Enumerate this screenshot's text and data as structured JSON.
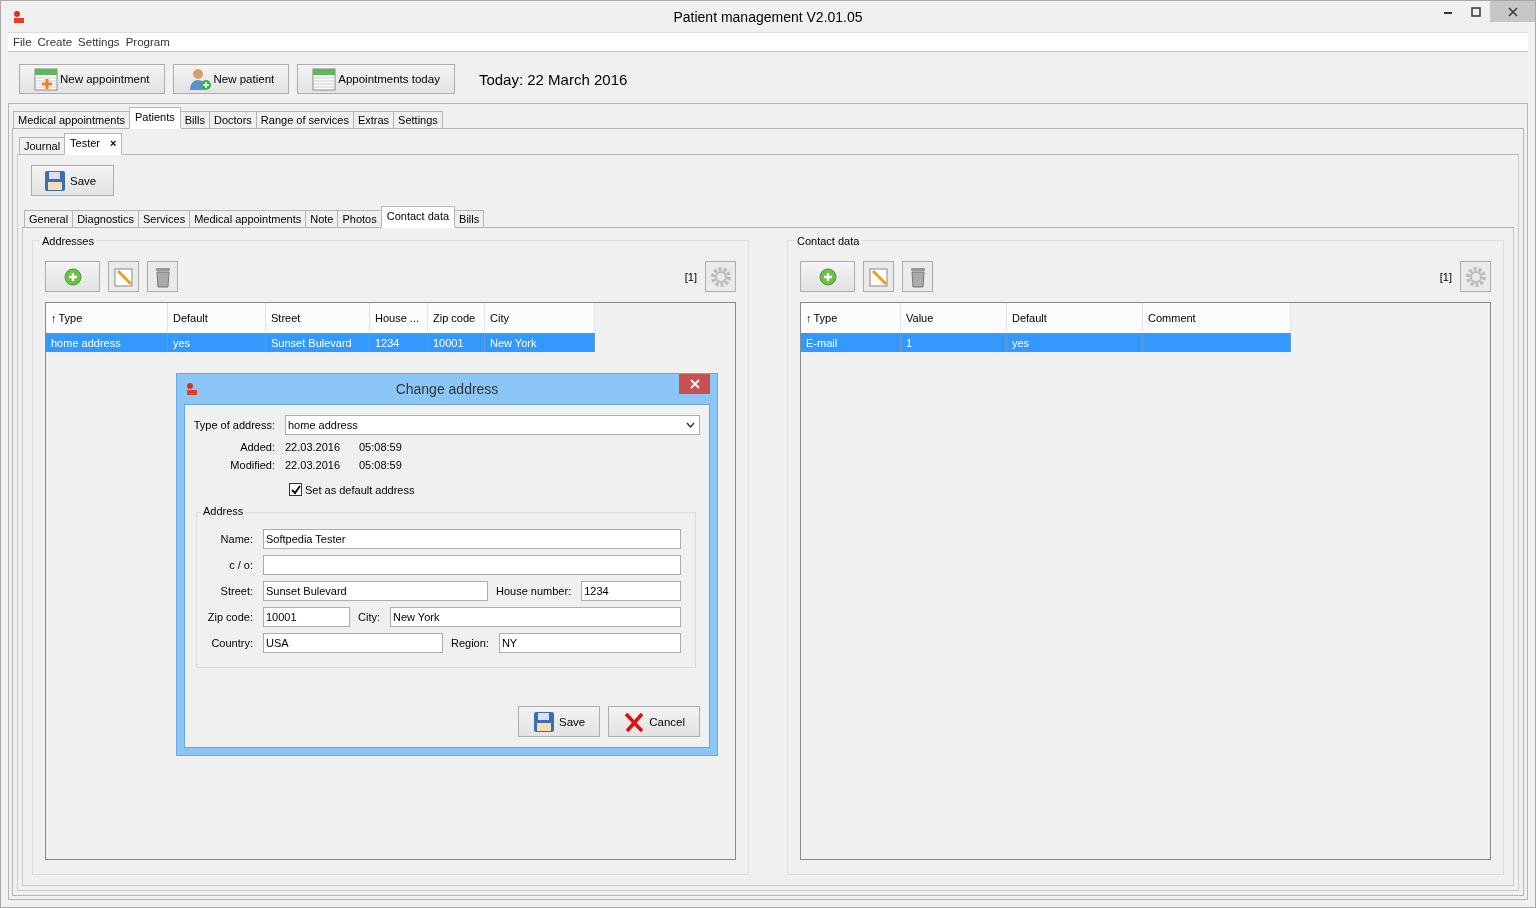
{
  "window": {
    "title": "Patient management V2.01.05"
  },
  "menu": [
    "File",
    "Create",
    "Settings",
    "Program"
  ],
  "toolbar": {
    "buttons": [
      {
        "label": "New appointment",
        "kind": "appointment"
      },
      {
        "label": "New patient",
        "kind": "patient"
      },
      {
        "label": "Appointments today",
        "kind": "calendar"
      }
    ],
    "today": "Today: 22 March 2016"
  },
  "main_tabs": [
    {
      "label": "Medical appointments",
      "selected": false
    },
    {
      "label": "Patients",
      "selected": true
    },
    {
      "label": "Bills",
      "selected": false
    },
    {
      "label": "Doctors",
      "selected": false
    },
    {
      "label": "Range of services",
      "selected": false
    },
    {
      "label": "Extras",
      "selected": false
    },
    {
      "label": "Settings",
      "selected": false
    }
  ],
  "patient_tabs": [
    {
      "label": "Journal",
      "selected": false
    },
    {
      "label": "Tester",
      "selected": true,
      "close": "×"
    }
  ],
  "save_button": "Save",
  "section_tabs": [
    {
      "label": "General",
      "selected": false
    },
    {
      "label": "Diagnostics",
      "selected": false
    },
    {
      "label": "Services",
      "selected": false
    },
    {
      "label": "Medical appointments",
      "selected": false
    },
    {
      "label": "Note",
      "selected": false
    },
    {
      "label": "Photos",
      "selected": false
    },
    {
      "label": "Contact data",
      "selected": true
    },
    {
      "label": "Bills",
      "selected": false
    }
  ],
  "addresses": {
    "title": "Addresses",
    "count": "[1]",
    "columns": [
      {
        "label": "Type",
        "sort": "↑"
      },
      {
        "label": "Default"
      },
      {
        "label": "Street"
      },
      {
        "label": "House ..."
      },
      {
        "label": "Zip code"
      },
      {
        "label": "City"
      }
    ],
    "rows": [
      {
        "selected": true,
        "cells": [
          "home address",
          "yes",
          "Sunset Bulevard",
          "1234",
          "10001",
          "New York"
        ]
      }
    ]
  },
  "contact_data": {
    "title": "Contact data",
    "count": "[1]",
    "columns": [
      {
        "label": "Type",
        "sort": "↑"
      },
      {
        "label": "Value"
      },
      {
        "label": "Default"
      },
      {
        "label": "Comment"
      }
    ],
    "rows": [
      {
        "selected": true,
        "cells": [
          "E-mail",
          "1",
          "yes",
          ""
        ]
      }
    ]
  },
  "dialog": {
    "title": "Change address",
    "type_label": "Type of address:",
    "type_value": "home address",
    "stamps": [
      {
        "label": "Added:",
        "date": "22.03.2016",
        "time": "05:08:59"
      },
      {
        "label": "Modified:",
        "date": "22.03.2016",
        "time": "05:08:59"
      }
    ],
    "default_checkbox": {
      "label": "Set as default address",
      "checked": true
    },
    "group_title": "Address",
    "field_rows": [
      [
        {
          "label": "Name:",
          "value": "Softpedia Tester"
        }
      ],
      [
        {
          "label": "c / o:"
        }
      ],
      [
        {
          "label": "Street:",
          "value": "Sunset Bulevard"
        },
        {
          "label": "House number:",
          "value": "1234"
        }
      ],
      [
        {
          "label": "Zip code:",
          "value": "10001"
        },
        {
          "label": "City:",
          "value": "New York"
        }
      ],
      [
        {
          "label": "Country:",
          "value": "USA"
        },
        {
          "label": "Region:",
          "value": "NY"
        }
      ]
    ],
    "buttons": [
      {
        "label": "Save",
        "kind": "save"
      },
      {
        "label": "Cancel",
        "kind": "cancel"
      }
    ]
  }
}
